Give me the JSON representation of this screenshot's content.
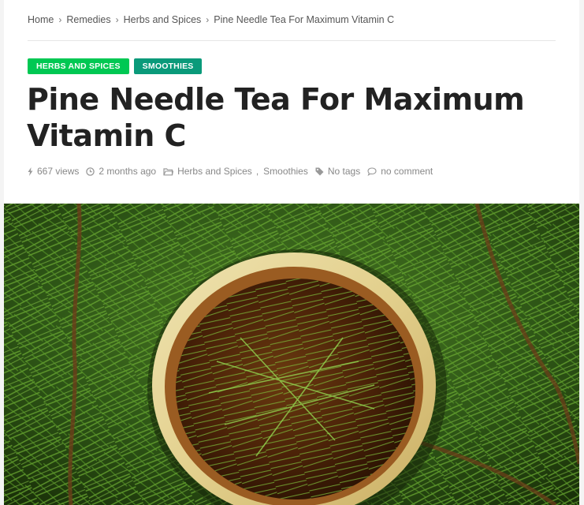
{
  "breadcrumb": {
    "items": [
      "Home",
      "Remedies",
      "Herbs and Spices",
      "Pine Needle Tea For Maximum Vitamin C"
    ]
  },
  "tags": [
    {
      "label": "HERBS AND SPICES",
      "color": "#00c853"
    },
    {
      "label": "SMOOTHIES",
      "color": "#0a9a7a"
    }
  ],
  "article": {
    "title": "Pine Needle Tea For Maximum Vitamin C"
  },
  "meta": {
    "views": "667 views",
    "date": "2 months ago",
    "categories": [
      "Herbs and Spices",
      "Smoothies"
    ],
    "category_separator": ",",
    "tags": "No tags",
    "comments": "no comment"
  },
  "icons": {
    "views": "bolt-icon",
    "date": "clock-icon",
    "category": "folder-icon",
    "tags": "tag-icon",
    "comments": "comment-icon",
    "breadcrumb_separator": "chevron-right-icon"
  },
  "colors": {
    "title": "#222222",
    "meta": "#888888",
    "tag_green": "#00c853",
    "tag_teal": "#0a9a7a"
  }
}
